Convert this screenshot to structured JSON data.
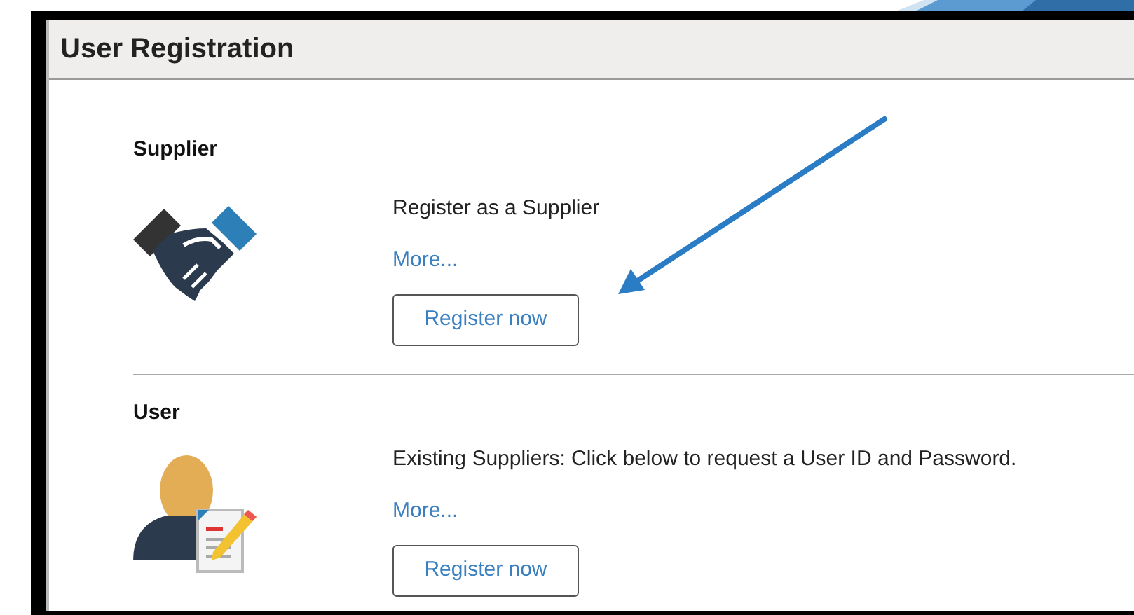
{
  "title": "User Registration",
  "sections": [
    {
      "kind": "supplier",
      "label": "Supplier",
      "description": "Register as a Supplier",
      "link": "More...",
      "button": "Register now"
    },
    {
      "kind": "user",
      "label": "User",
      "description": "Existing Suppliers:  Click below to request a User ID and Password.",
      "link": "More...",
      "button": "Register now"
    }
  ]
}
